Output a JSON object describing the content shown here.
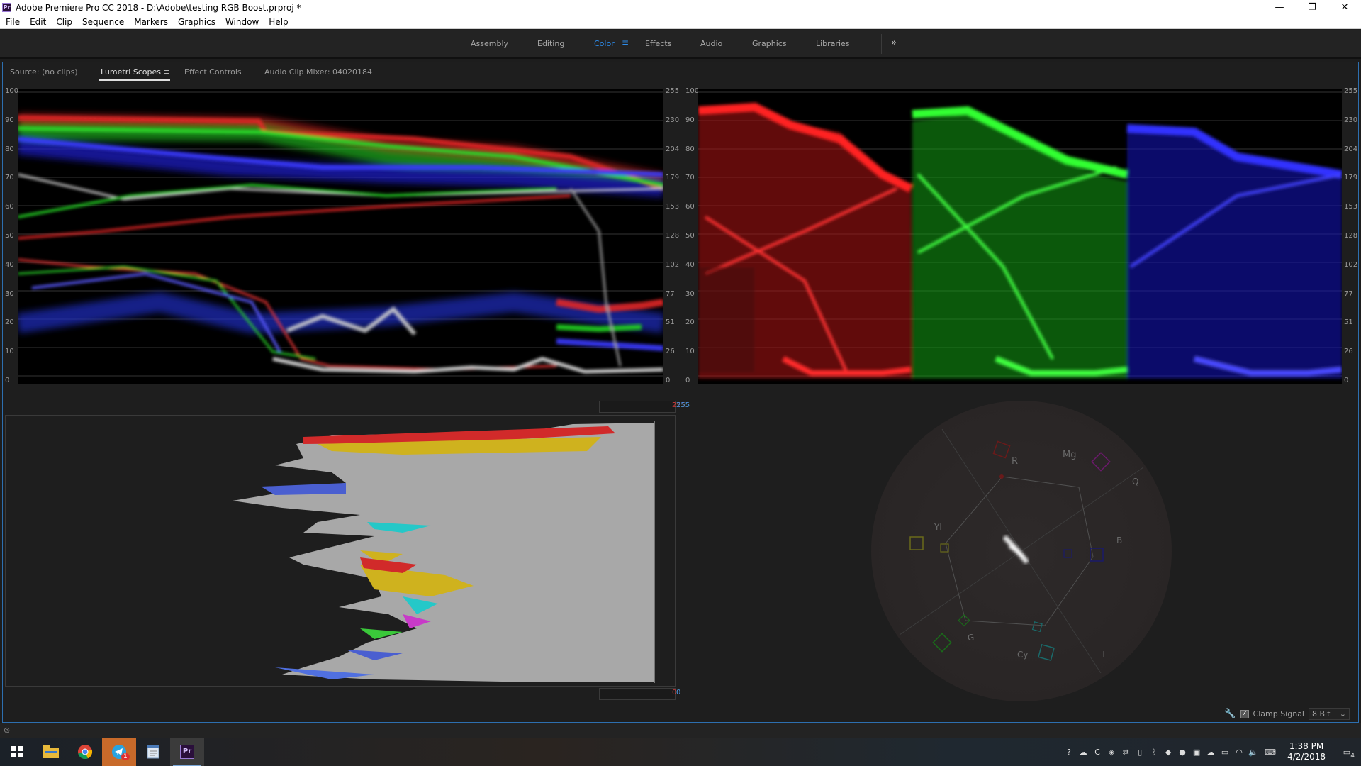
{
  "window": {
    "title": "Adobe Premiere Pro CC 2018 - D:\\Adobe\\testing RGB Boost.prproj *",
    "app_icon_text": "Pr",
    "minimize": "—",
    "restore": "❐",
    "close": "✕"
  },
  "menu": [
    "File",
    "Edit",
    "Clip",
    "Sequence",
    "Markers",
    "Graphics",
    "Window",
    "Help"
  ],
  "workspaces": {
    "tabs": [
      "Assembly",
      "Editing",
      "Color",
      "Effects",
      "Audio",
      "Graphics",
      "Libraries"
    ],
    "active": "Color",
    "menu_glyph": "≡",
    "more_glyph": "»"
  },
  "panel": {
    "tabs": [
      "Source: (no clips)",
      "Lumetri Scopes",
      "Effect Controls",
      "Audio Clip Mixer: 04020184"
    ],
    "active_tab": "Lumetri Scopes",
    "tab_menu_glyph": "≡"
  },
  "waveform": {
    "left_scale": [
      "100",
      "90",
      "80",
      "70",
      "60",
      "50",
      "40",
      "30",
      "20",
      "10",
      "0"
    ],
    "right_scale": [
      "255",
      "230",
      "204",
      "179",
      "153",
      "128",
      "102",
      "77",
      "51",
      "26",
      "0"
    ]
  },
  "parade": {
    "left_scale": [
      "100",
      "90",
      "80",
      "70",
      "60",
      "50",
      "40",
      "30",
      "20",
      "10",
      "0"
    ],
    "right_scale": [
      "255",
      "230",
      "204",
      "179",
      "153",
      "128",
      "102",
      "77",
      "51",
      "26",
      "0"
    ]
  },
  "histogram": {
    "top_readout": {
      "r": "255",
      "g": "255",
      "b": "255"
    },
    "bottom_readout": {
      "r": "0",
      "g": "0",
      "b": "0"
    }
  },
  "vectorscope": {
    "labels": {
      "r": "R",
      "mg": "Mg",
      "q": "Q",
      "yl": "Yl",
      "b": "B",
      "g": "G",
      "cy": "Cy",
      "neg_i": "-I"
    }
  },
  "scope_settings": {
    "clamp_label": "Clamp Signal",
    "clamp_checked": true,
    "bit_depth": "8 Bit"
  },
  "taskbar": {
    "apps": [
      "windows-start",
      "file-explorer",
      "chrome",
      "telegram",
      "notepad",
      "premiere-pro"
    ],
    "telegram_badge": "1",
    "clock_time": "1:38 PM",
    "clock_date": "4/2/2018",
    "notification_count": "4"
  },
  "colors": {
    "accent_blue": "#2d8ceb",
    "red_channel": "#e0151a",
    "green_channel": "#15d11a",
    "blue_channel": "#1a22e6",
    "histogram_fill": "#a8a8a8"
  }
}
